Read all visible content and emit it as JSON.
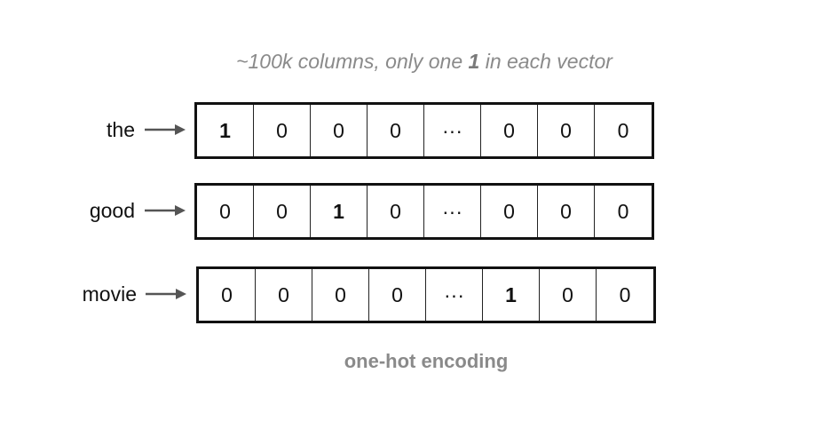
{
  "title": {
    "before": "~100k columns, only one ",
    "emphasis": "1",
    "after": " in each vector"
  },
  "rows": [
    {
      "word": "the",
      "cells": [
        "1",
        "0",
        "0",
        "0",
        "···",
        "0",
        "0",
        "0"
      ],
      "hot_index": 0
    },
    {
      "word": "good",
      "cells": [
        "0",
        "0",
        "1",
        "0",
        "···",
        "0",
        "0",
        "0"
      ],
      "hot_index": 2
    },
    {
      "word": "movie",
      "cells": [
        "0",
        "0",
        "0",
        "0",
        "···",
        "1",
        "0",
        "0"
      ],
      "hot_index": 5
    }
  ],
  "caption": "one-hot encoding",
  "colors": {
    "title_gray": "#8a8a8a",
    "text": "#111111",
    "arrow": "#555555"
  },
  "icons": {
    "row_arrow": "right-arrow-icon"
  }
}
